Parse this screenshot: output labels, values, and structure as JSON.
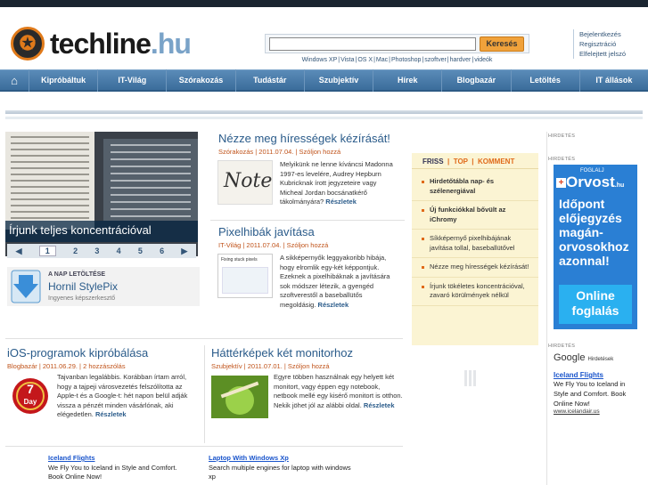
{
  "header": {
    "logo_text": "techline",
    "logo_tld": ".hu",
    "search_button": "Keresés",
    "quick_links": [
      "Windows XP",
      "Vista",
      "OS X",
      "Mac",
      "Photoshop",
      "szoftver",
      "hardver",
      "videók"
    ],
    "user_links": [
      "Bejelentkezés",
      "Regisztráció",
      "Elfelejtett jelszó"
    ]
  },
  "nav": [
    "Kipróbáltuk",
    "IT-Világ",
    "Szórakozás",
    "Tudástár",
    "Szubjektív",
    "Hírek",
    "Blogbazár",
    "Letöltés",
    "IT állások"
  ],
  "featured": {
    "caption": "Írjunk teljes koncentrációval",
    "pages": [
      "1",
      "2",
      "3",
      "4",
      "5",
      "6"
    ],
    "prev": "◀",
    "next": "▶"
  },
  "download": {
    "kicker": "A NAP LETÖLTÉSE",
    "title": "Hornil StylePix",
    "subtitle": "Ingyenes képszerkesztő"
  },
  "articles": [
    {
      "title": "Nézze meg hírességek kézírását!",
      "meta": "Szórakozás | 2011.07.04. | Szóljon hozzá",
      "text": "Melyikünk ne lenne kíváncsi Madonna 1997-es levelére, Audrey Hepburn Kubricknak írott jegyzeteire vagy Micheal Jordan bocsánatkérő tákolmányára?",
      "more": "Részletek",
      "thumb_word": "Note"
    },
    {
      "title": "Pixelhibák javítása",
      "meta": "IT-Világ | 2011.07.04. | Szóljon hozzá",
      "text": "A sikképernyők leggyakoribb hibája, hogy elromlik egy-két képpontjuk. Ezeknek a pixelhibáknak a javítására sok módszer létezik, a gyengéd szoftverestől a baseballütős megoldásig.",
      "more": "Részletek",
      "thumb_title": "Fixing stuck pixels"
    },
    {
      "title": "iOS-programok kipróbálása",
      "meta": "Blogbazár | 2011.06.29. | 2 hozzászólás",
      "text": "Tajvanban legalábbis. Korábban írtam arról, hogy a tajpeji városvezetés felszólította az Apple-t és a Google-t: hét napon belül adják vissza a pénzét minden vásárlónak, aki elégedetlen.",
      "more": "Részletek",
      "badge_top": "7",
      "badge_bottom": "Day"
    },
    {
      "title": "Háttérképek két monitorhoz",
      "meta": "Szubjektív | 2011.07.01. | Szóljon hozzá",
      "text": "Egyre többen használnak egy helyett két monitort, vagy éppen egy notebook, netbook mellé egy kisérő monitort is otthon. Nekik jöhet jól az alábbi oldal.",
      "more": "Részletek"
    }
  ],
  "friss": {
    "tabs": [
      "FRISS",
      "TOP",
      "KOMMENT"
    ],
    "items": [
      {
        "text": "Hirdetőtábla nap- és szélenergiával",
        "bold": true
      },
      {
        "text": "Új funkciókkal bővült az iChromy",
        "bold": true
      },
      {
        "text": "Síkképernyő pixelhibájának javítása tollal, baseballütővel",
        "bold": false
      },
      {
        "text": "Nézze meg hírességek kézírását!",
        "bold": false
      },
      {
        "text": "Írjunk tökéletes koncentrációval, zavaró körülmények nélkül",
        "bold": false
      }
    ]
  },
  "ads": {
    "label": "HIRDETÉS",
    "orvost_tag": "FOGLALJ",
    "orvost_brand": "Orvost",
    "orvost_tld": ".hu",
    "orvost_text": "Időpont előjegyzés magán-orvosokhoz azonnal!",
    "orvost_button": "Online foglalás",
    "google_logo": "Google",
    "google_label": "Hirdetések",
    "google_ad": {
      "title": "Iceland Flights",
      "desc": "We Fly You to Iceland in Style and Comfort. Book Online Now!",
      "url": "www.icelandair.us"
    },
    "bottom_ads": [
      {
        "title": "Iceland Flights",
        "desc": "We Fly You to Iceland in Style and Comfort. Book Online Now!"
      },
      {
        "title": "Laptop With Windows Xp",
        "desc": "Search multiple engines for laptop with windows xp"
      }
    ]
  },
  "colors": {
    "nav": "#3b6d9b",
    "title_link": "#2a5b8a",
    "meta": "#c0531a",
    "accent": "#e07a1a",
    "friss_bg": "#fbf4d3",
    "orvost_bg": "#2a7fd4"
  },
  "icons": [
    "home-icon",
    "download-arrow-icon",
    "logo-icon"
  ]
}
